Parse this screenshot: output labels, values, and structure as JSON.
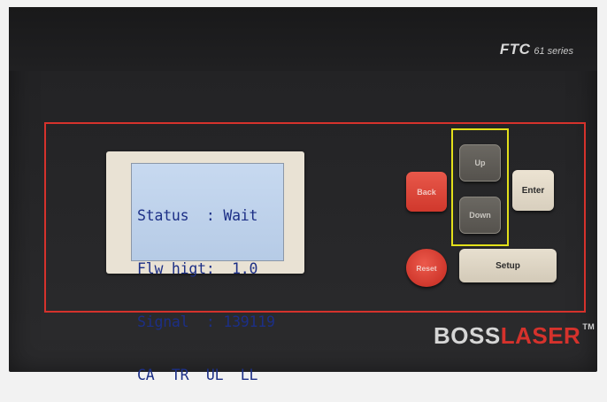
{
  "header": {
    "model_name": "FTC",
    "model_series": "61 series"
  },
  "lcd": {
    "lines": [
      "Status  : Wait",
      "Flw higt:  1.0",
      "Signal  : 139119",
      "CA  TR  UL  LL"
    ]
  },
  "buttons": {
    "back": "Back",
    "up": "Up",
    "down": "Down",
    "enter": "Enter",
    "reset": "Reset",
    "setup": "Setup"
  },
  "brand": {
    "part1": "BOSS",
    "part2": "LASER",
    "trademark": "TM"
  },
  "colors": {
    "frame_red": "#d5322c",
    "highlight_yellow": "#e3e01a",
    "lcd_background": "#c0d3ec",
    "lcd_text": "#1c2f86"
  }
}
